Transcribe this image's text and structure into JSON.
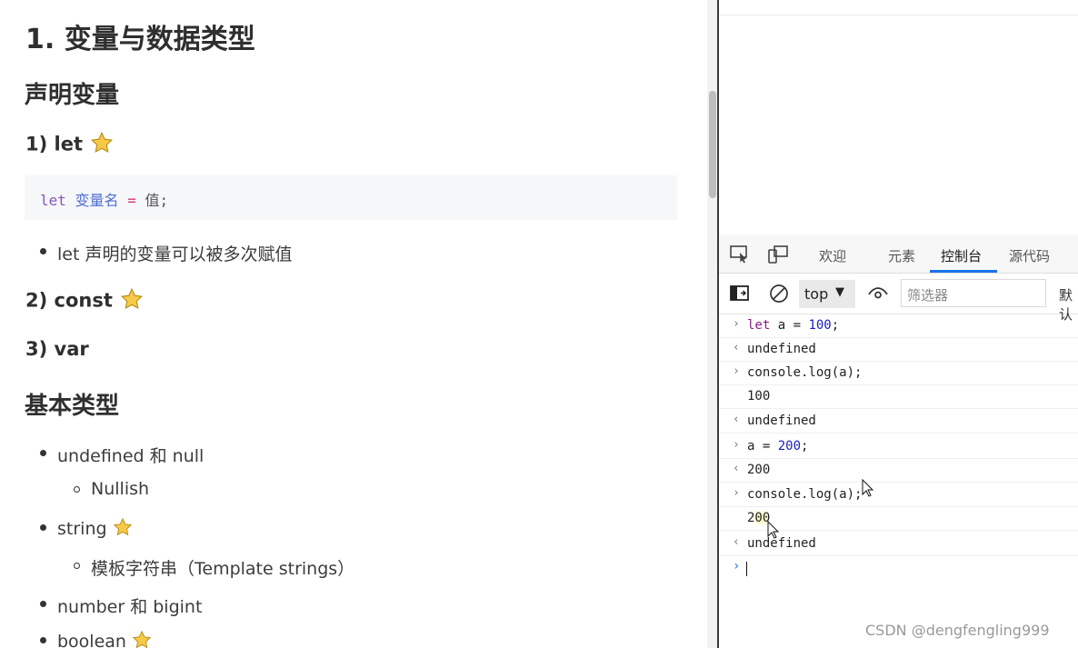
{
  "doc": {
    "h1": "1. 变量与数据类型",
    "section_declare": "声明变量",
    "let_heading": "1) let",
    "code": {
      "kw": "let",
      "name": "变量名",
      "eq": "=",
      "val": "值;"
    },
    "let_note": "let 声明的变量可以被多次赋值",
    "const_heading": "2) const",
    "var_heading": "3) var",
    "section_basic": "基本类型",
    "types": [
      {
        "label": "undefined 和 null",
        "sub": "Nullish"
      },
      {
        "label": "string",
        "sub": "模板字符串（Template strings）"
      },
      {
        "label": "number 和 bigint"
      },
      {
        "label": "boolean"
      }
    ],
    "star_color": "#f7c948"
  },
  "devtools": {
    "tabs": [
      "欢迎",
      "元素",
      "控制台",
      "源代码"
    ],
    "active_tab": "控制台",
    "context": "top",
    "filter_placeholder": "筛选器",
    "default_levels": "默认",
    "console": [
      {
        "kind": "input",
        "text": "let a = 100;"
      },
      {
        "kind": "return",
        "text": "undefined"
      },
      {
        "kind": "input",
        "text": "console.log(a);"
      },
      {
        "kind": "log",
        "text": "100"
      },
      {
        "kind": "return",
        "text": "undefined"
      },
      {
        "kind": "input",
        "text": "a = 200;"
      },
      {
        "kind": "return",
        "text": "200"
      },
      {
        "kind": "input",
        "text": "console.log(a);"
      },
      {
        "kind": "log",
        "text": "200"
      },
      {
        "kind": "return",
        "text": "undefined"
      }
    ],
    "accent": "#1a73e8"
  },
  "watermark": "CSDN @dengfengling999"
}
